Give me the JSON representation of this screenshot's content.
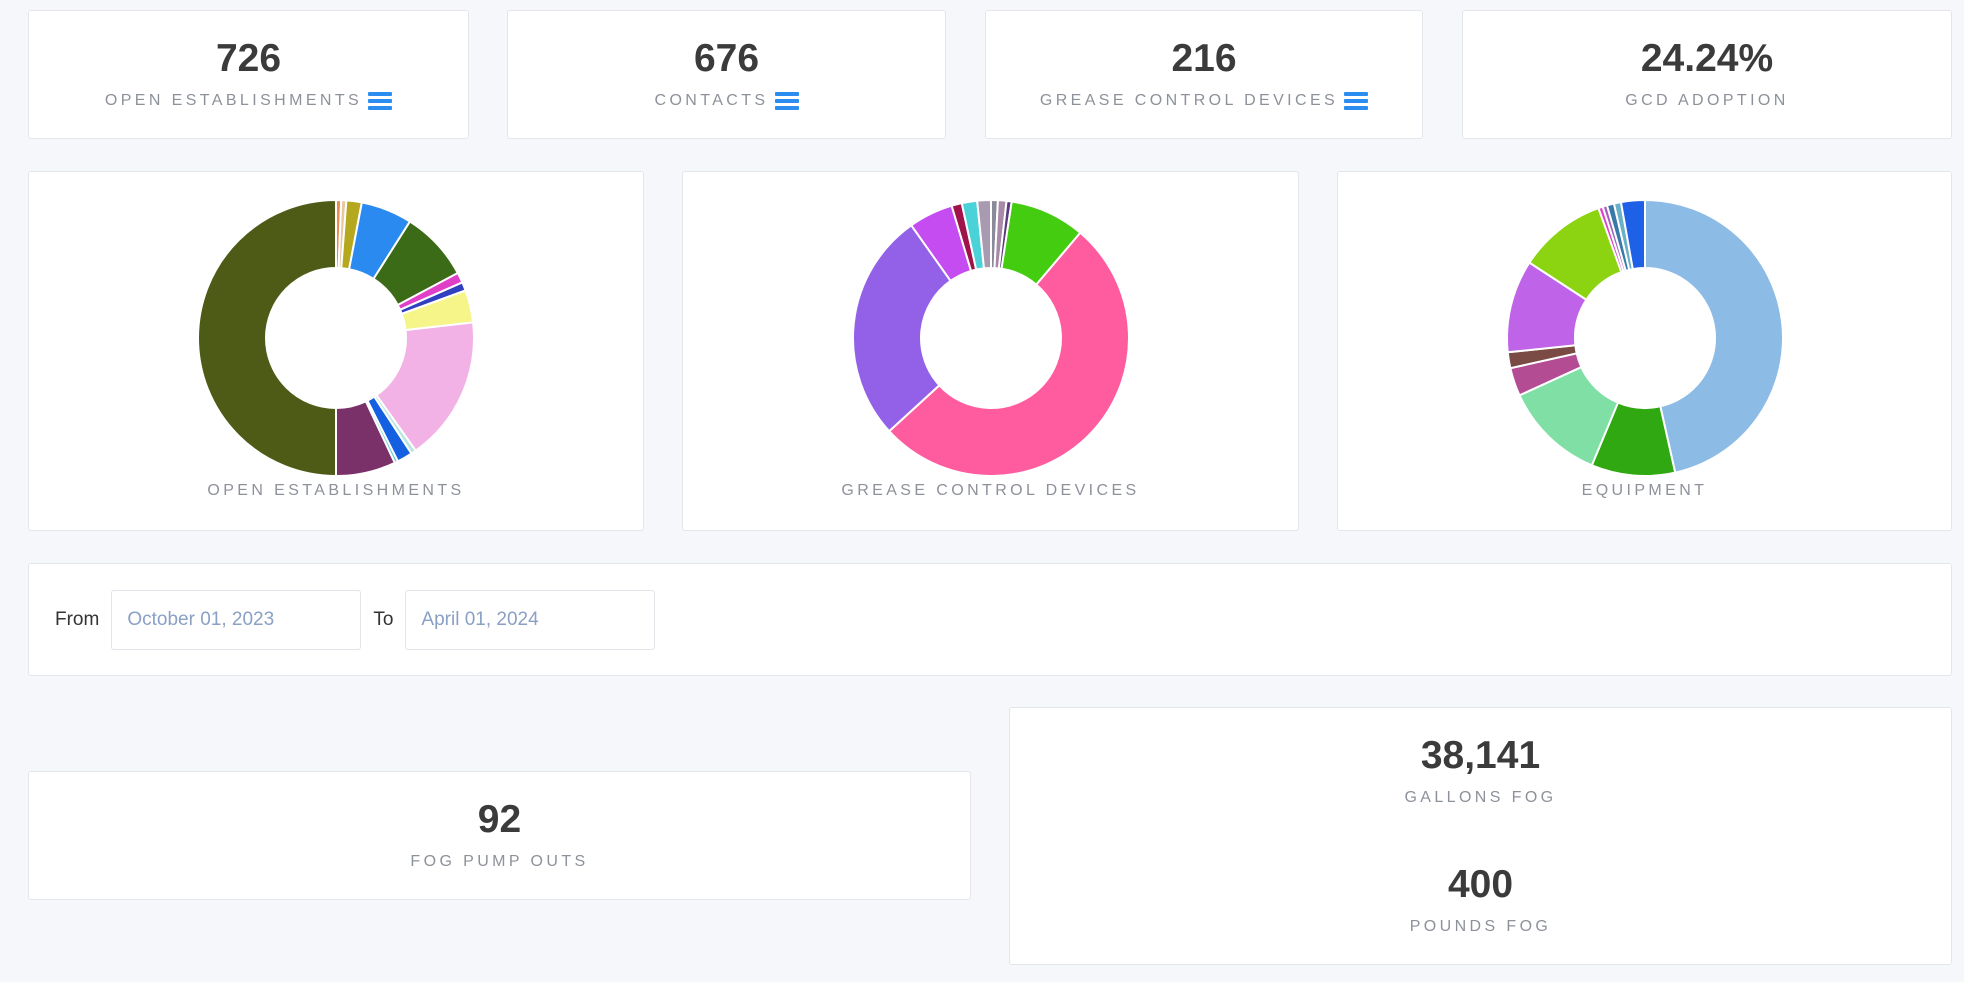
{
  "stats": {
    "open_establishments": {
      "value": "726",
      "label": "OPEN ESTABLISHMENTS"
    },
    "contacts": {
      "value": "676",
      "label": "CONTACTS"
    },
    "grease_control_devices": {
      "value": "216",
      "label": "GREASE CONTROL DEVICES"
    },
    "gcd_adoption": {
      "value": "24.24%",
      "label": "GCD ADOPTION"
    }
  },
  "charts": {
    "establishments": {
      "caption": "OPEN ESTABLISHMENTS",
      "slices": [
        {
          "value": 0.6,
          "color": "#f08a4b"
        },
        {
          "value": 0.6,
          "color": "#e8c8a0"
        },
        {
          "value": 1.8,
          "color": "#b5a71e"
        },
        {
          "value": 6.0,
          "color": "#2b8af0"
        },
        {
          "value": 8.2,
          "color": "#3b6b16"
        },
        {
          "value": 1.2,
          "color": "#e040c8"
        },
        {
          "value": 1.0,
          "color": "#3040c0"
        },
        {
          "value": 3.8,
          "color": "#f5f58a"
        },
        {
          "value": 17.0,
          "color": "#f3b2e6"
        },
        {
          "value": 0.6,
          "color": "#b9e6e0"
        },
        {
          "value": 1.8,
          "color": "#1560e0"
        },
        {
          "value": 0.4,
          "color": "#6ad0d8"
        },
        {
          "value": 7.0,
          "color": "#7a3068"
        },
        {
          "value": 50.0,
          "color": "#4d5b17"
        }
      ]
    },
    "gcd": {
      "caption": "GREASE CONTROL DEVICES",
      "slices": [
        {
          "value": 0.8,
          "color": "#8a8a9a"
        },
        {
          "value": 1.0,
          "color": "#a88aa8"
        },
        {
          "value": 0.6,
          "color": "#5a3a7a"
        },
        {
          "value": 8.8,
          "color": "#44cc11"
        },
        {
          "value": 52.0,
          "color": "#ff5c9f"
        },
        {
          "value": 27.0,
          "color": "#9360e8"
        },
        {
          "value": 5.2,
          "color": "#c44cf0"
        },
        {
          "value": 1.2,
          "color": "#a0124a"
        },
        {
          "value": 1.8,
          "color": "#4ad2d8"
        },
        {
          "value": 1.6,
          "color": "#a89ab0"
        }
      ]
    },
    "equipment": {
      "caption": "EQUIPMENT",
      "slices": [
        {
          "value": 45.0,
          "color": "#8cbbe5"
        },
        {
          "value": 9.5,
          "color": "#2fa812"
        },
        {
          "value": 11.5,
          "color": "#80dfa5"
        },
        {
          "value": 3.2,
          "color": "#b44c94"
        },
        {
          "value": 1.8,
          "color": "#7a4a44"
        },
        {
          "value": 10.5,
          "color": "#bf63e8"
        },
        {
          "value": 10.0,
          "color": "#8cd412"
        },
        {
          "value": 0.5,
          "color": "#e040c8"
        },
        {
          "value": 0.5,
          "color": "#a060c0"
        },
        {
          "value": 0.8,
          "color": "#3a7aa8"
        },
        {
          "value": 0.8,
          "color": "#6ab0c8"
        },
        {
          "value": 2.7,
          "color": "#1e60e6"
        }
      ]
    }
  },
  "date_filter": {
    "from_label": "From",
    "from_value": "October 01, 2023",
    "to_label": "To",
    "to_value": "April 01, 2024"
  },
  "fog": {
    "pump_outs": {
      "value": "92",
      "label": "FOG PUMP OUTS"
    },
    "gallons": {
      "value": "38,141",
      "label": "GALLONS FOG"
    },
    "pounds": {
      "value": "400",
      "label": "POUNDS FOG"
    }
  },
  "colors": {
    "accent": "#2d8cf0",
    "background": "#f6f7fb"
  }
}
